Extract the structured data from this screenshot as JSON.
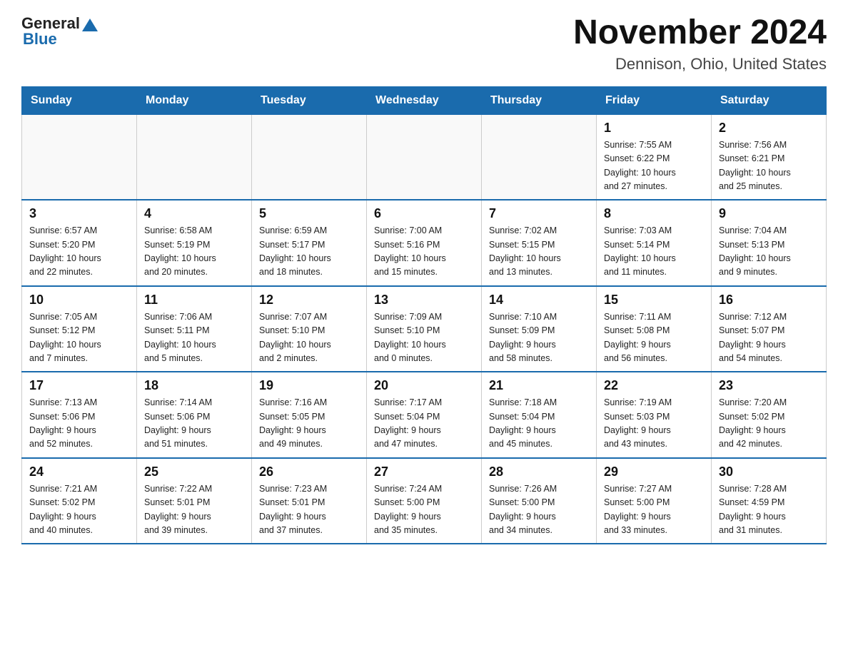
{
  "header": {
    "logo_general": "General",
    "logo_blue": "Blue",
    "title": "November 2024",
    "subtitle": "Dennison, Ohio, United States"
  },
  "weekdays": [
    "Sunday",
    "Monday",
    "Tuesday",
    "Wednesday",
    "Thursday",
    "Friday",
    "Saturday"
  ],
  "weeks": [
    [
      {
        "day": "",
        "info": ""
      },
      {
        "day": "",
        "info": ""
      },
      {
        "day": "",
        "info": ""
      },
      {
        "day": "",
        "info": ""
      },
      {
        "day": "",
        "info": ""
      },
      {
        "day": "1",
        "info": "Sunrise: 7:55 AM\nSunset: 6:22 PM\nDaylight: 10 hours\nand 27 minutes."
      },
      {
        "day": "2",
        "info": "Sunrise: 7:56 AM\nSunset: 6:21 PM\nDaylight: 10 hours\nand 25 minutes."
      }
    ],
    [
      {
        "day": "3",
        "info": "Sunrise: 6:57 AM\nSunset: 5:20 PM\nDaylight: 10 hours\nand 22 minutes."
      },
      {
        "day": "4",
        "info": "Sunrise: 6:58 AM\nSunset: 5:19 PM\nDaylight: 10 hours\nand 20 minutes."
      },
      {
        "day": "5",
        "info": "Sunrise: 6:59 AM\nSunset: 5:17 PM\nDaylight: 10 hours\nand 18 minutes."
      },
      {
        "day": "6",
        "info": "Sunrise: 7:00 AM\nSunset: 5:16 PM\nDaylight: 10 hours\nand 15 minutes."
      },
      {
        "day": "7",
        "info": "Sunrise: 7:02 AM\nSunset: 5:15 PM\nDaylight: 10 hours\nand 13 minutes."
      },
      {
        "day": "8",
        "info": "Sunrise: 7:03 AM\nSunset: 5:14 PM\nDaylight: 10 hours\nand 11 minutes."
      },
      {
        "day": "9",
        "info": "Sunrise: 7:04 AM\nSunset: 5:13 PM\nDaylight: 10 hours\nand 9 minutes."
      }
    ],
    [
      {
        "day": "10",
        "info": "Sunrise: 7:05 AM\nSunset: 5:12 PM\nDaylight: 10 hours\nand 7 minutes."
      },
      {
        "day": "11",
        "info": "Sunrise: 7:06 AM\nSunset: 5:11 PM\nDaylight: 10 hours\nand 5 minutes."
      },
      {
        "day": "12",
        "info": "Sunrise: 7:07 AM\nSunset: 5:10 PM\nDaylight: 10 hours\nand 2 minutes."
      },
      {
        "day": "13",
        "info": "Sunrise: 7:09 AM\nSunset: 5:10 PM\nDaylight: 10 hours\nand 0 minutes."
      },
      {
        "day": "14",
        "info": "Sunrise: 7:10 AM\nSunset: 5:09 PM\nDaylight: 9 hours\nand 58 minutes."
      },
      {
        "day": "15",
        "info": "Sunrise: 7:11 AM\nSunset: 5:08 PM\nDaylight: 9 hours\nand 56 minutes."
      },
      {
        "day": "16",
        "info": "Sunrise: 7:12 AM\nSunset: 5:07 PM\nDaylight: 9 hours\nand 54 minutes."
      }
    ],
    [
      {
        "day": "17",
        "info": "Sunrise: 7:13 AM\nSunset: 5:06 PM\nDaylight: 9 hours\nand 52 minutes."
      },
      {
        "day": "18",
        "info": "Sunrise: 7:14 AM\nSunset: 5:06 PM\nDaylight: 9 hours\nand 51 minutes."
      },
      {
        "day": "19",
        "info": "Sunrise: 7:16 AM\nSunset: 5:05 PM\nDaylight: 9 hours\nand 49 minutes."
      },
      {
        "day": "20",
        "info": "Sunrise: 7:17 AM\nSunset: 5:04 PM\nDaylight: 9 hours\nand 47 minutes."
      },
      {
        "day": "21",
        "info": "Sunrise: 7:18 AM\nSunset: 5:04 PM\nDaylight: 9 hours\nand 45 minutes."
      },
      {
        "day": "22",
        "info": "Sunrise: 7:19 AM\nSunset: 5:03 PM\nDaylight: 9 hours\nand 43 minutes."
      },
      {
        "day": "23",
        "info": "Sunrise: 7:20 AM\nSunset: 5:02 PM\nDaylight: 9 hours\nand 42 minutes."
      }
    ],
    [
      {
        "day": "24",
        "info": "Sunrise: 7:21 AM\nSunset: 5:02 PM\nDaylight: 9 hours\nand 40 minutes."
      },
      {
        "day": "25",
        "info": "Sunrise: 7:22 AM\nSunset: 5:01 PM\nDaylight: 9 hours\nand 39 minutes."
      },
      {
        "day": "26",
        "info": "Sunrise: 7:23 AM\nSunset: 5:01 PM\nDaylight: 9 hours\nand 37 minutes."
      },
      {
        "day": "27",
        "info": "Sunrise: 7:24 AM\nSunset: 5:00 PM\nDaylight: 9 hours\nand 35 minutes."
      },
      {
        "day": "28",
        "info": "Sunrise: 7:26 AM\nSunset: 5:00 PM\nDaylight: 9 hours\nand 34 minutes."
      },
      {
        "day": "29",
        "info": "Sunrise: 7:27 AM\nSunset: 5:00 PM\nDaylight: 9 hours\nand 33 minutes."
      },
      {
        "day": "30",
        "info": "Sunrise: 7:28 AM\nSunset: 4:59 PM\nDaylight: 9 hours\nand 31 minutes."
      }
    ]
  ]
}
